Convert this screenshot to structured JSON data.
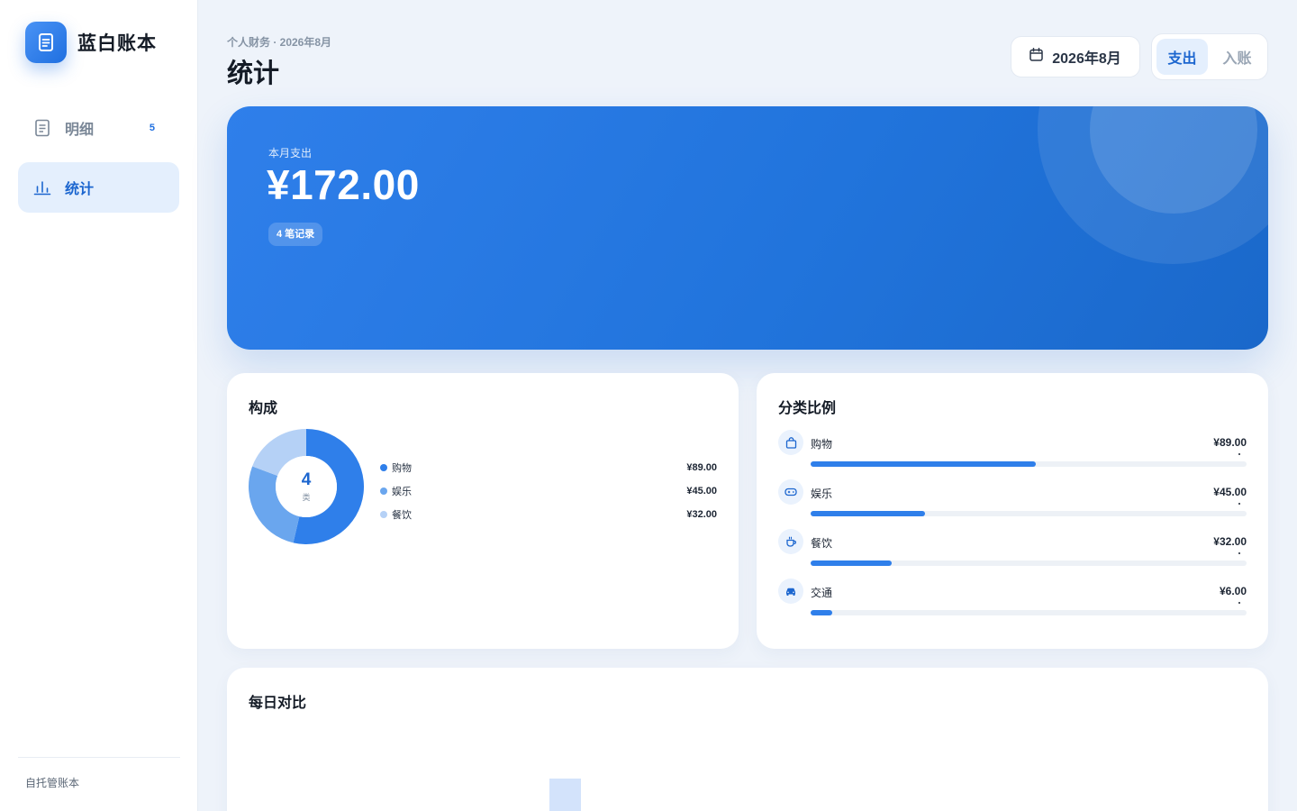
{
  "app": {
    "name": "蓝白账本"
  },
  "sidebar": {
    "items": [
      {
        "label": "明细",
        "icon": "document-icon",
        "badge": "5",
        "active": false
      },
      {
        "label": "统计",
        "icon": "bar-chart-icon",
        "badge": "",
        "active": true
      }
    ],
    "footer": "自托管账本"
  },
  "header": {
    "subtitle": "个人财务 · 2026年8月",
    "title": "统计",
    "month_picker": "2026年8月",
    "segment": {
      "expense": "支出",
      "income": "入账",
      "selected": "支出"
    }
  },
  "hero": {
    "label": "本月支出",
    "amount": "¥172.00",
    "records": "4 笔记录"
  },
  "composition": {
    "title": "构成",
    "count": "4",
    "unit": "类",
    "legend": [
      {
        "name": "购物",
        "value": "¥89.00",
        "color": "#2f7fea"
      },
      {
        "name": "娱乐",
        "value": "¥45.00",
        "color": "#6aa6ee"
      },
      {
        "name": "餐饮",
        "value": "¥32.00",
        "color": "#b5d1f6"
      }
    ]
  },
  "categories": {
    "title": "分类比例",
    "items": [
      {
        "name": "购物",
        "amount": "¥89.00",
        "icon": "shopping-bag-icon",
        "share": 0.517
      },
      {
        "name": "娱乐",
        "amount": "¥45.00",
        "icon": "gamepad-icon",
        "share": 0.262
      },
      {
        "name": "餐饮",
        "amount": "¥32.00",
        "icon": "coffee-cup-icon",
        "share": 0.186
      },
      {
        "name": "交通",
        "amount": "¥6.00",
        "icon": "car-icon",
        "share": 0.05
      }
    ]
  },
  "daily": {
    "title": "每日对比"
  },
  "colors": {
    "accent": "#1f6fe0",
    "background": "#eef3fa",
    "active_bg": "#e4effd"
  }
}
